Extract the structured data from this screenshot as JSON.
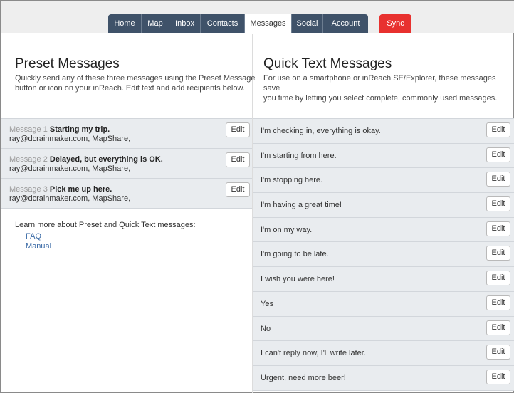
{
  "nav": {
    "tabs": [
      {
        "label": "Home",
        "width": 47
      },
      {
        "label": "Map",
        "width": 39
      },
      {
        "label": "Inbox",
        "width": 44
      },
      {
        "label": "Contacts",
        "width": 62
      },
      {
        "label": "Messages",
        "width": 66,
        "active": true
      },
      {
        "label": "Social",
        "width": 44
      },
      {
        "label": "Account",
        "width": 63
      }
    ],
    "sync_label": "Sync"
  },
  "preset": {
    "title": "Preset Messages",
    "description_line1": "Quickly send any of these three messages using the Preset Message",
    "description_line2": "button or icon on your inReach. Edit text and add recipients below.",
    "messages": [
      {
        "number": "Message 1",
        "text": "Starting my trip.",
        "recipients": "ray@dcrainmaker.com, MapShare,",
        "edit": "Edit"
      },
      {
        "number": "Message 2",
        "text": "Delayed, but everything is OK.",
        "recipients": "ray@dcrainmaker.com, MapShare,",
        "edit": "Edit"
      },
      {
        "number": "Message 3",
        "text": "Pick me up here.",
        "recipients": "ray@dcrainmaker.com, MapShare,",
        "edit": "Edit"
      }
    ],
    "learn_more": "Learn more about Preset and Quick Text messages:",
    "links": [
      "FAQ",
      "Manual"
    ]
  },
  "quick": {
    "title": "Quick Text Messages",
    "description_line1": "For use on a smartphone or inReach SE/Explorer, these messages save",
    "description_line2": "you time by letting you select complete, commonly used messages.",
    "messages": [
      "I'm checking in, everything is okay.",
      "I'm starting from here.",
      "I'm stopping here.",
      "I'm having a great time!",
      "I'm on my way.",
      "I'm going to be late.",
      "I wish you were here!",
      "Yes",
      "No",
      "I can't reply now, I'll write later.",
      "Urgent, need more beer!"
    ],
    "edit_label": "Edit"
  }
}
